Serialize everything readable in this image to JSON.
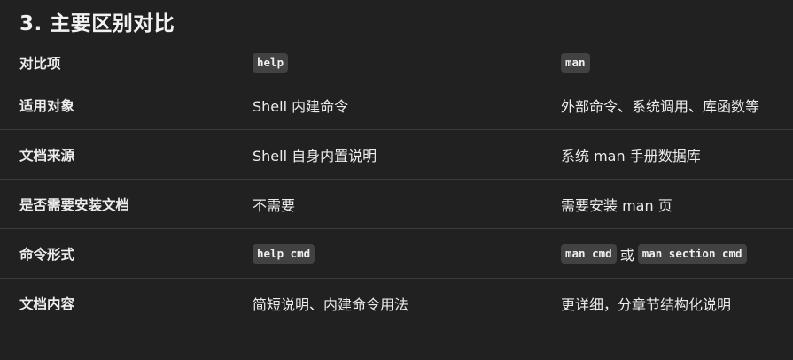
{
  "heading": "3. 主要区别对比",
  "table": {
    "headers": [
      "对比项",
      "help",
      "man"
    ],
    "rows": [
      {
        "item": "适用对象",
        "help": "Shell 内建命令",
        "man": "外部命令、系统调用、库函数等"
      },
      {
        "item": "文档来源",
        "help": "Shell 自身内置说明",
        "man": "系统 man 手册数据库"
      },
      {
        "item": "是否需要安装文档",
        "help": "不需要",
        "man": "需要安装 man 页"
      },
      {
        "item": "命令形式",
        "help_code": "help cmd",
        "man_code_1": "man cmd",
        "man_sep": "或",
        "man_code_2": "man section cmd"
      },
      {
        "item": "文档内容",
        "help": "简短说明、内建命令用法",
        "man": "更详细，分章节结构化说明"
      }
    ]
  }
}
